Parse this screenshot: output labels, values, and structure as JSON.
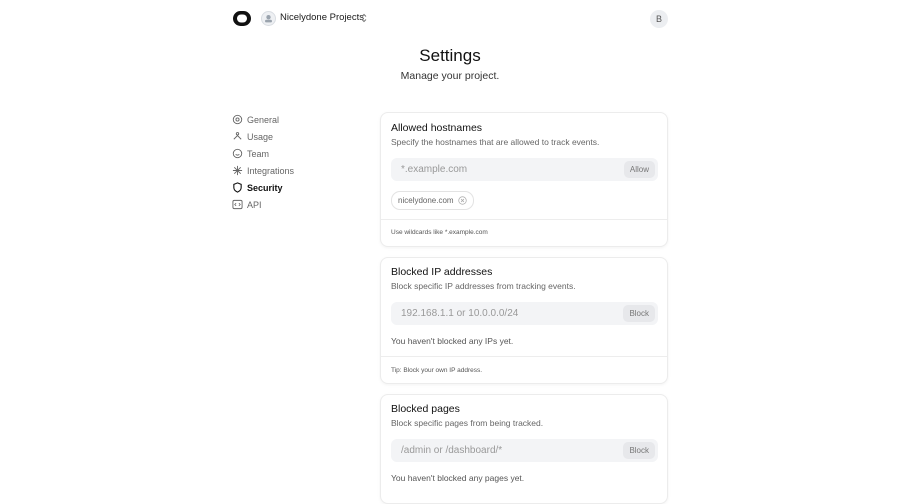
{
  "header": {
    "project_name": "Nicelydone Projects",
    "user_initial": "B"
  },
  "page": {
    "title": "Settings",
    "subtitle": "Manage your project."
  },
  "sidebar": {
    "items": [
      {
        "label": "General",
        "icon": "gear-icon",
        "active": false
      },
      {
        "label": "Usage",
        "icon": "usage-icon",
        "active": false
      },
      {
        "label": "Team",
        "icon": "team-icon",
        "active": false
      },
      {
        "label": "Integrations",
        "icon": "integrations-icon",
        "active": false
      },
      {
        "label": "Security",
        "icon": "shield-icon",
        "active": true
      },
      {
        "label": "API",
        "icon": "code-icon",
        "active": false
      }
    ]
  },
  "hostnames": {
    "title": "Allowed hostnames",
    "description": "Specify the hostnames that are allowed to track events.",
    "placeholder": "*.example.com",
    "button": "Allow",
    "chips": [
      "nicelydone.com"
    ],
    "footer": "Use wildcards like *.example.com"
  },
  "blocked_ips": {
    "title": "Blocked IP addresses",
    "description": "Block specific IP addresses from tracking events.",
    "placeholder": "192.168.1.1 or 10.0.0.0/24",
    "button": "Block",
    "empty": "You haven't blocked any IPs yet.",
    "footer": "Tip: Block your own IP address."
  },
  "blocked_pages": {
    "title": "Blocked pages",
    "description": "Block specific pages from being tracked.",
    "placeholder": "/admin or /dashboard/*",
    "button": "Block",
    "empty": "You haven't blocked any pages yet."
  }
}
